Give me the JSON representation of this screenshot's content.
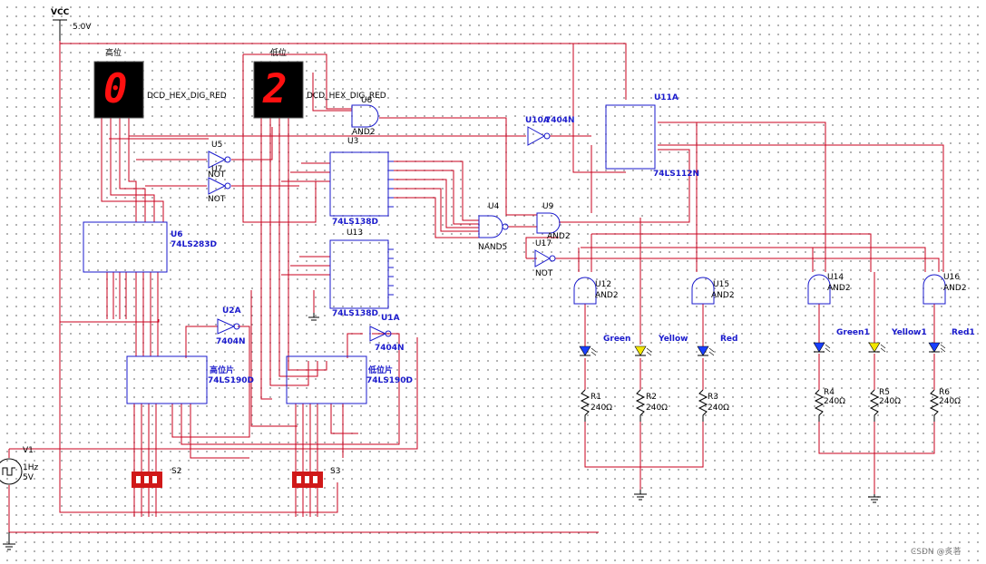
{
  "power": {
    "label": "VCC",
    "value": "5.0V"
  },
  "displays": {
    "high": {
      "title": "高位",
      "digit": "0",
      "part": "DCD_HEX_DIG_RED"
    },
    "low": {
      "title": "低位",
      "digit": "2",
      "part": "DCD_HEX_DIG_RED"
    }
  },
  "parts": {
    "u8": {
      "ref": "U8",
      "type": "AND2"
    },
    "u5": {
      "ref": "U5",
      "type": "NOT"
    },
    "u7": {
      "ref": "U7",
      "type": "NOT"
    },
    "u3": {
      "ref": "U3",
      "type": "74LS138D"
    },
    "u13": {
      "ref": "U13",
      "type": "74LS138D"
    },
    "u6": {
      "ref": "U6",
      "type": "74LS283D"
    },
    "u10": {
      "ref": "U10A",
      "type": "7404N"
    },
    "u11": {
      "ref": "U11A",
      "type": "74LS112N"
    },
    "u4": {
      "ref": "U4",
      "type": "NAND5"
    },
    "u9": {
      "ref": "U9",
      "type": "AND2"
    },
    "u17": {
      "ref": "U17",
      "type": "NOT"
    },
    "u2": {
      "ref": "U2A",
      "type": "7404N"
    },
    "u1": {
      "ref": "U1A",
      "type": "7404N"
    },
    "hi_counter": {
      "name": "高位片",
      "type": "74LS190D"
    },
    "lo_counter": {
      "name": "低位片",
      "type": "74LS190D"
    },
    "u12": {
      "ref": "U12",
      "type": "AND2"
    },
    "u15": {
      "ref": "U15",
      "type": "AND2"
    },
    "u14": {
      "ref": "U14",
      "type": "AND2"
    },
    "u16": {
      "ref": "U16",
      "type": "AND2"
    }
  },
  "switches": {
    "s2": "S2",
    "s3": "S3"
  },
  "source": {
    "ref": "V1",
    "freq": "1Hz",
    "amp": "5V"
  },
  "leds": [
    {
      "label": "Green",
      "color": "#1a3fff"
    },
    {
      "label": "Yellow",
      "color": "#f2e600"
    },
    {
      "label": "Red",
      "color": "#1a3fff"
    },
    {
      "label": "Green1",
      "color": "#1a3fff"
    },
    {
      "label": "Yellow1",
      "color": "#f2e600"
    },
    {
      "label": "Red1",
      "color": "#1a3fff"
    }
  ],
  "resistors": [
    {
      "ref": "R1",
      "value": "240Ω"
    },
    {
      "ref": "R2",
      "value": "240Ω"
    },
    {
      "ref": "R3",
      "value": "240Ω"
    },
    {
      "ref": "R4",
      "value": "240Ω"
    },
    {
      "ref": "R5",
      "value": "240Ω"
    },
    {
      "ref": "R6",
      "value": "240Ω"
    }
  ],
  "watermark": "CSDN @炙茗",
  "colors": {
    "wire": "#c8001e",
    "component": "#1a1acc",
    "switch": "#d01818",
    "segment": "#ff1010"
  }
}
